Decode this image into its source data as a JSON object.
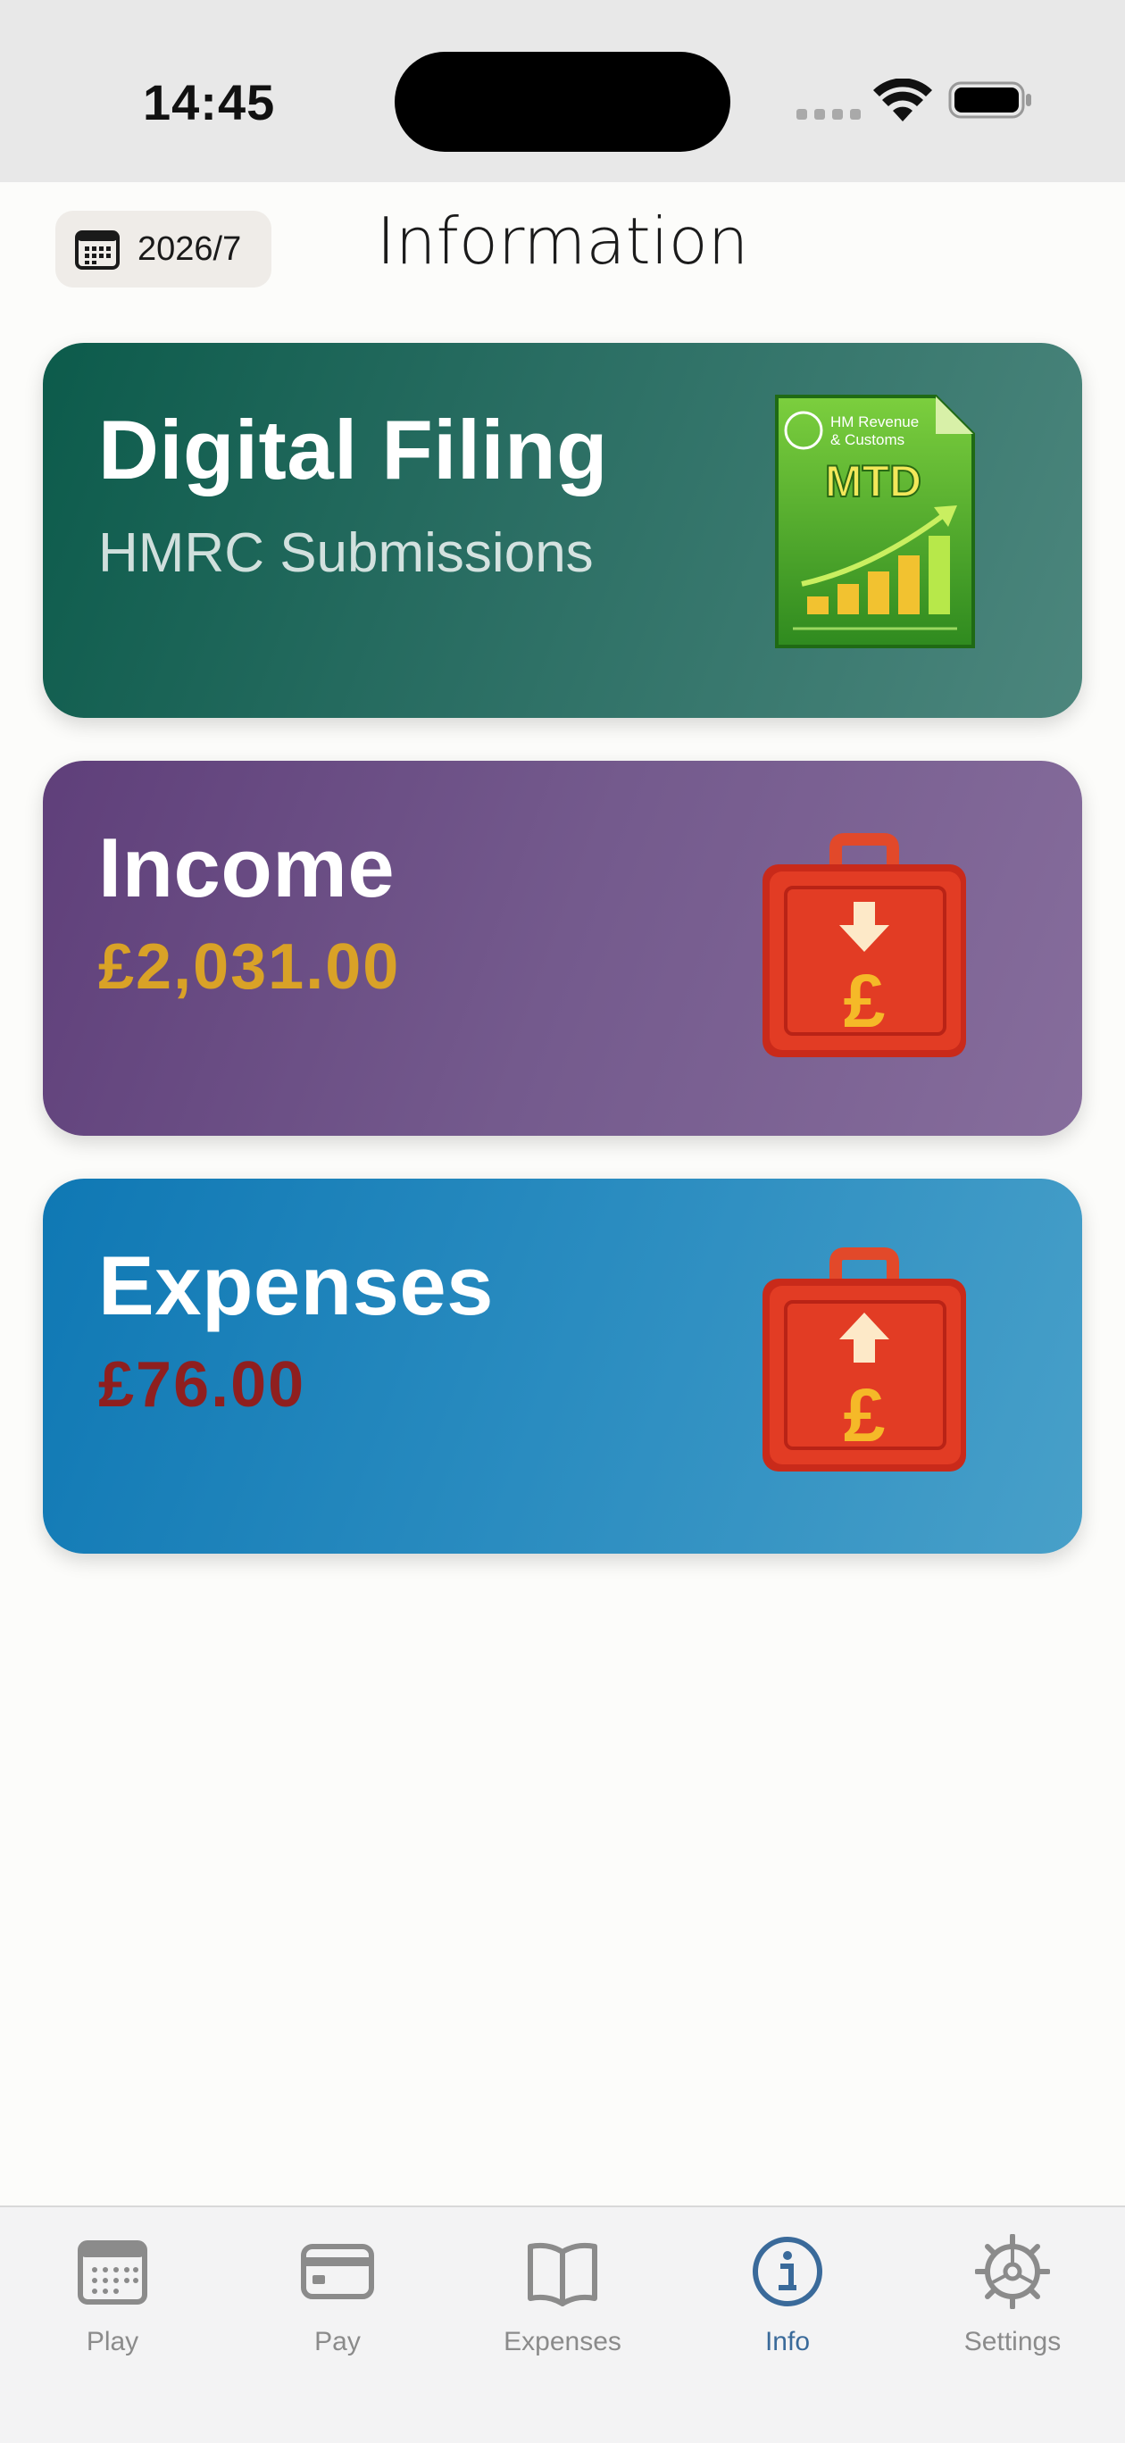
{
  "status_bar": {
    "time": "14:45"
  },
  "header": {
    "month": "2026/7",
    "title": "Information"
  },
  "cards": {
    "filing": {
      "title": "Digital Filing",
      "subtitle": "HMRC Submissions",
      "badge_org_line1": "HM Revenue",
      "badge_org_line2": "& Customs",
      "badge_text": "MTD"
    },
    "income": {
      "title": "Income",
      "amount": "£2,031.00",
      "amount_color": "#d9a227"
    },
    "expenses": {
      "title": "Expenses",
      "amount": "£76.00",
      "amount_color": "#8f1f1f"
    }
  },
  "tabs": [
    {
      "label": "Play",
      "icon": "calendar-icon",
      "active": false
    },
    {
      "label": "Pay",
      "icon": "card-icon",
      "active": false
    },
    {
      "label": "Expenses",
      "icon": "book-icon",
      "active": false
    },
    {
      "label": "Info",
      "icon": "info-icon",
      "active": true
    },
    {
      "label": "Settings",
      "icon": "gear-icon",
      "active": false
    }
  ],
  "colors": {
    "active_tab": "#3a6a9a",
    "inactive_tab": "#8b8b8b"
  }
}
